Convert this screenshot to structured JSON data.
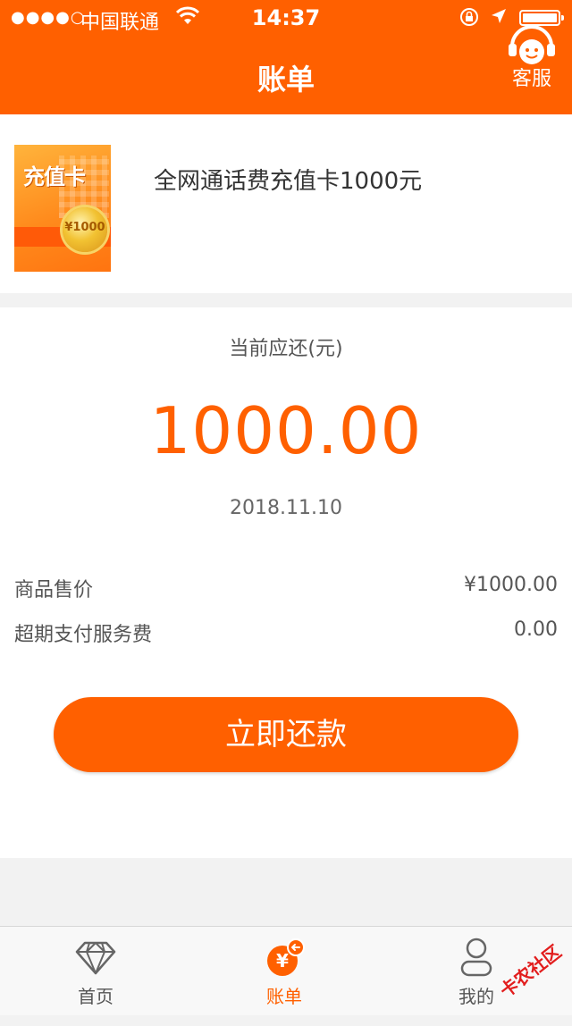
{
  "status_bar": {
    "signal": "●●●●○",
    "carrier": "中国联通",
    "time": "14:37"
  },
  "nav": {
    "title": "账单",
    "customer_service": "客服"
  },
  "product": {
    "thumb_title": "充值卡",
    "thumb_value": "¥1000",
    "name": "全网通话费充值卡1000元"
  },
  "bill": {
    "due_label": "当前应还(元)",
    "due_amount": "1000.00",
    "due_date": "2018.11.10",
    "details": [
      {
        "label": "商品售价",
        "value": "¥1000.00"
      },
      {
        "label": "超期支付服务费",
        "value": "0.00"
      }
    ],
    "repay_button": "立即还款"
  },
  "tab_bar": {
    "tabs": [
      {
        "label": "首页",
        "icon": "diamond-icon",
        "active": false
      },
      {
        "label": "账单",
        "icon": "yuan-bill-icon",
        "active": true
      },
      {
        "label": "我的",
        "icon": "user-icon",
        "active": false
      }
    ]
  },
  "watermark": {
    "text": "卡农社区"
  },
  "colors": {
    "brand": "#ff6000",
    "background": "#f2f2f2",
    "text": "#333333"
  }
}
